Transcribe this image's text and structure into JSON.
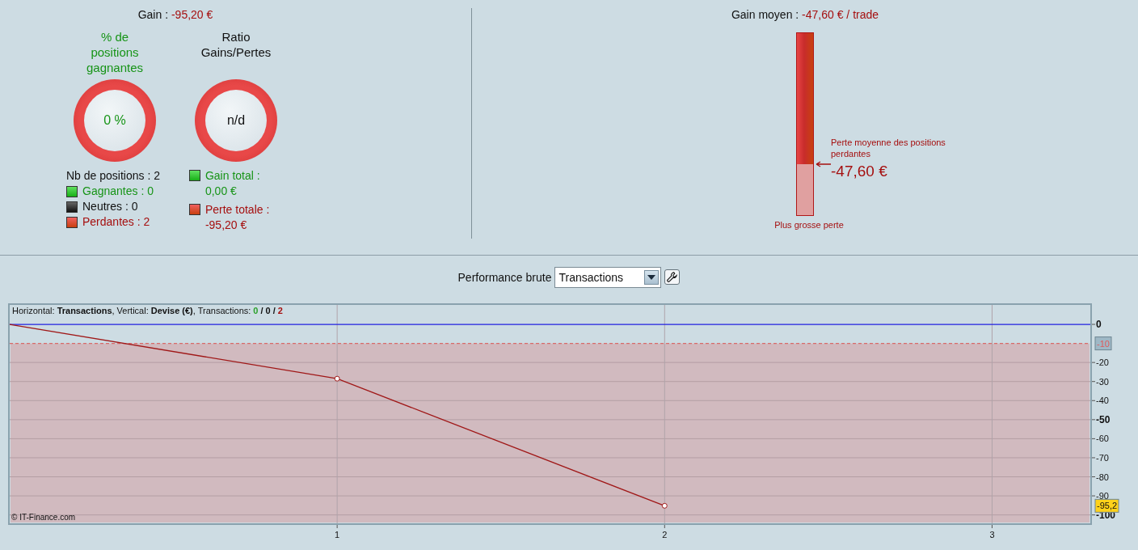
{
  "summary": {
    "gain_label": "Gain :",
    "gain_value": "-95,20 €",
    "gauges": [
      {
        "title": "% de positions gagnantes",
        "value": "0 %",
        "kind": "gain"
      },
      {
        "title": "Ratio Gains/Pertes",
        "value": "n/d",
        "kind": "neutral"
      }
    ],
    "positions_total": "Nb de positions : 2",
    "counts": [
      {
        "label": "Gagnantes : 0",
        "kind": "gain"
      },
      {
        "label": "Neutres : 0",
        "kind": "neutral"
      },
      {
        "label": "Perdantes : 2",
        "kind": "loss"
      }
    ],
    "totals": [
      {
        "label": "Gain total :",
        "value": "0,00 €",
        "kind": "gain"
      },
      {
        "label": "Perte totale :",
        "value": "-95,20 €",
        "kind": "loss"
      }
    ]
  },
  "average": {
    "label": "Gain moyen :",
    "value": "-47,60 € / trade",
    "level": 0.72,
    "marker_label": "Perte moyenne des positions perdantes",
    "marker_value": "-47,60 €",
    "bottom_label": "Plus grosse perte"
  },
  "performance": {
    "label": "Performance brute",
    "select": {
      "value": "Transactions"
    },
    "header": {
      "text": "Horizontal: **Transactions**, Vertical: **Devise (€)**, Transactions:",
      "separator": "/",
      "counts": [
        {
          "value": "0",
          "kind": "gain"
        },
        {
          "value": "0",
          "kind": "neutral"
        },
        {
          "value": "2",
          "kind": "loss"
        }
      ]
    },
    "copyright": "© IT-Finance.com",
    "chart_data": {
      "type": "line",
      "x": [
        0,
        1,
        2
      ],
      "series": [
        {
          "color": "#a01818",
          "values": [
            0,
            -28.5,
            -95.2
          ]
        }
      ],
      "xlim": [
        0,
        3.3
      ],
      "ylim": [
        -104.4,
        10.2
      ],
      "xticks": [
        1,
        2,
        3
      ],
      "yticks": [
        0,
        -20,
        -30,
        -40,
        -50,
        -60,
        -70,
        -80,
        -90,
        -100
      ],
      "grid": true,
      "ref_lines": [
        {
          "axis": "y",
          "value": 0,
          "color": "#2020e0"
        },
        {
          "axis": "y",
          "value": -10,
          "label": "-10",
          "color": "#d86a6a"
        }
      ],
      "bands": [
        {
          "axis": "y",
          "from": -104.4,
          "to": -10,
          "color": "#d1babf"
        }
      ],
      "annotations": [
        "-95,2"
      ]
    }
  }
}
